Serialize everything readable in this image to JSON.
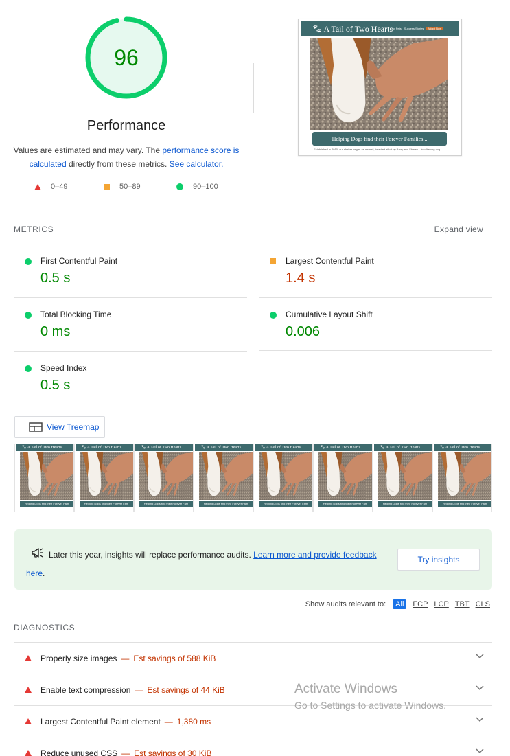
{
  "score": {
    "value": "96",
    "title": "Performance",
    "desc_prefix": "Values are estimated and may vary. The ",
    "desc_link1": "performance score is calculated",
    "desc_middle": " directly from these metrics. ",
    "desc_link2": "See calculator.",
    "fraction": 0.96,
    "color": "#0cce6b"
  },
  "legend": [
    {
      "range": "0–49",
      "color": "#e53935"
    },
    {
      "range": "50–89",
      "color": "#f4a534"
    },
    {
      "range": "90–100",
      "color": "#0cce6b"
    }
  ],
  "final_screenshot": {
    "site_title": "A Tail of Two Hearts",
    "nav": [
      "Our Pets",
      "Success Stories",
      "Adopt Now"
    ],
    "banner": "Helping Dogs find their Forever Families...",
    "body_text": "Established in 2010, our shelter began as a small, heartfelt effort by Barry and Sheree – two lifelong dog"
  },
  "metrics": {
    "heading": "METRICS",
    "expand": "Expand view",
    "items": [
      {
        "name": "First Contentful Paint",
        "value": "0.5 s",
        "status": "green"
      },
      {
        "name": "Largest Contentful Paint",
        "value": "1.4 s",
        "status": "orange"
      },
      {
        "name": "Total Blocking Time",
        "value": "0 ms",
        "status": "green"
      },
      {
        "name": "Cumulative Layout Shift",
        "value": "0.006",
        "status": "green"
      },
      {
        "name": "Speed Index",
        "value": "0.5 s",
        "status": "green"
      }
    ]
  },
  "treemap": {
    "label": "View Treemap"
  },
  "filmstrip": {
    "frame_count": 8,
    "frame_title": "A Tail of Two Hearts",
    "frame_banner": "Helping Dogs find their Forever Fam"
  },
  "notice": {
    "text": "Later this year, insights will replace performance audits. ",
    "link": "Learn more and provide feedback here",
    "end": ".",
    "button": "Try insights"
  },
  "filter": {
    "label": "Show audits relevant to:",
    "chips": [
      "All",
      "FCP",
      "LCP",
      "TBT",
      "CLS"
    ],
    "active": "All"
  },
  "diagnostics": {
    "heading": "DIAGNOSTICS",
    "items": [
      {
        "title": "Properly size images",
        "detail": "Est savings of 588 KiB"
      },
      {
        "title": "Enable text compression",
        "detail": "Est savings of 44 KiB"
      },
      {
        "title": "Largest Contentful Paint element",
        "detail": "1,380 ms"
      },
      {
        "title": "Reduce unused CSS",
        "detail": "Est savings of 30 KiB"
      }
    ]
  },
  "watermark": {
    "line1": "Activate Windows",
    "line2": "Go to Settings to activate Windows."
  }
}
